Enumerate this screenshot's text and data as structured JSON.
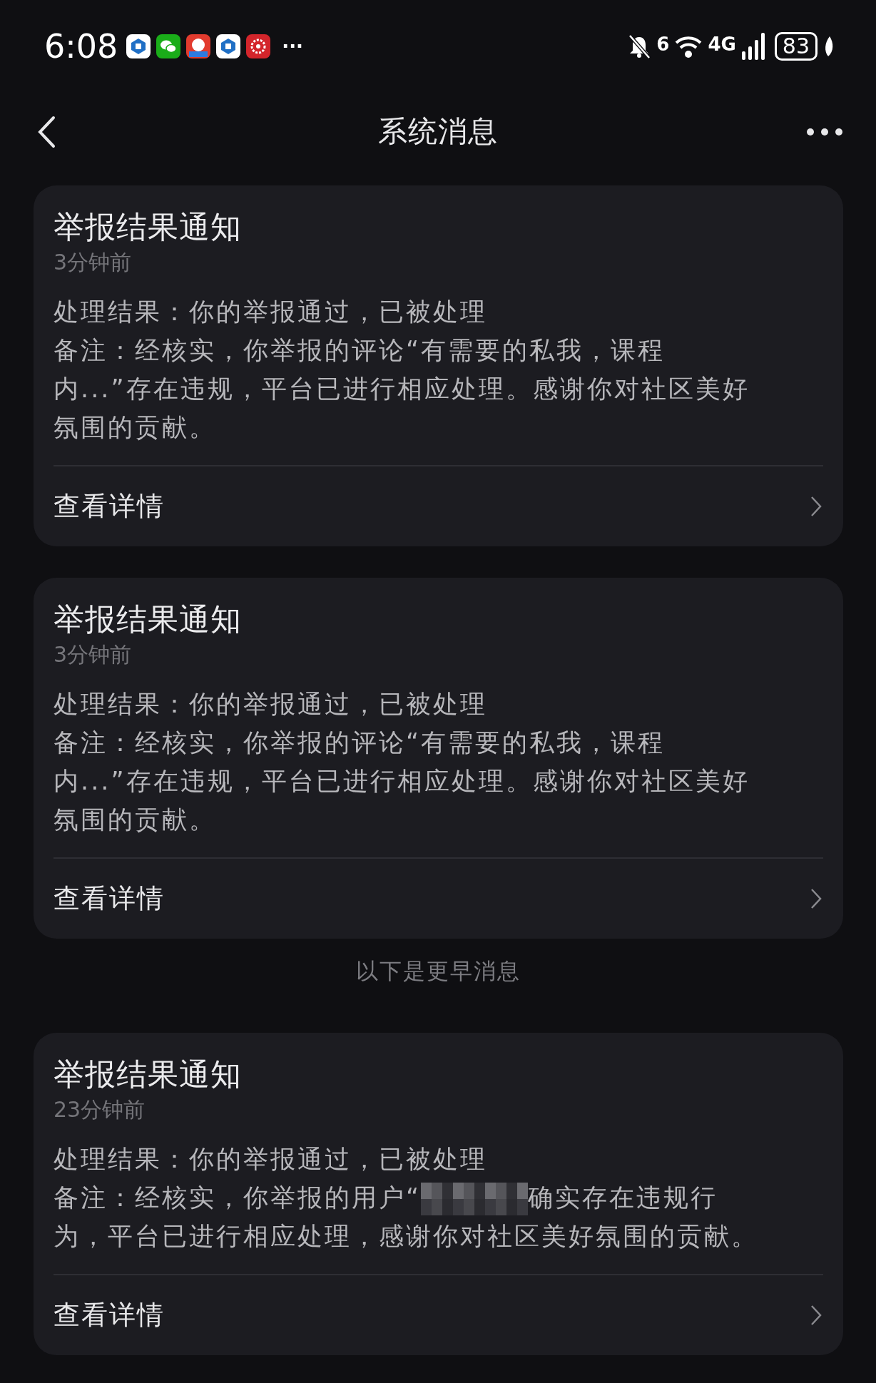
{
  "status_bar": {
    "time": "6:08",
    "more": "···",
    "wifi_label": "6",
    "network": "4G",
    "battery": "83"
  },
  "header": {
    "title": "系统消息"
  },
  "sections": [
    {
      "kind": "cards",
      "cards": [
        {
          "title": "举报结果通知",
          "time": "3分钟前",
          "result": "处理结果：你的举报通过，已被处理",
          "note": "备注：经核实，你举报的评论“有需要的私我，课程内...”存在违规，平台已进行相应处理。感谢你对社区美好氛围的贡献。",
          "link": "查看详情"
        },
        {
          "title": "举报结果通知",
          "time": "3分钟前",
          "result": "处理结果：你的举报通过，已被处理",
          "note": "备注：经核实，你举报的评论“有需要的私我，课程内...”存在违规，平台已进行相应处理。感谢你对社区美好氛围的贡献。",
          "link": "查看详情"
        }
      ]
    },
    {
      "kind": "divider",
      "text": "以下是更早消息"
    },
    {
      "kind": "cards",
      "cards": [
        {
          "title": "举报结果通知",
          "time": "23分钟前",
          "result": "处理结果：你的举报通过，已被处理",
          "note": "备注：经核实，你举报的用户“",
          "redacted": true,
          "note_after": "确实存在违规行为，平台已进行相应处理，感谢你对社区美好氛围的贡献。",
          "link": "查看详情"
        }
      ]
    }
  ]
}
